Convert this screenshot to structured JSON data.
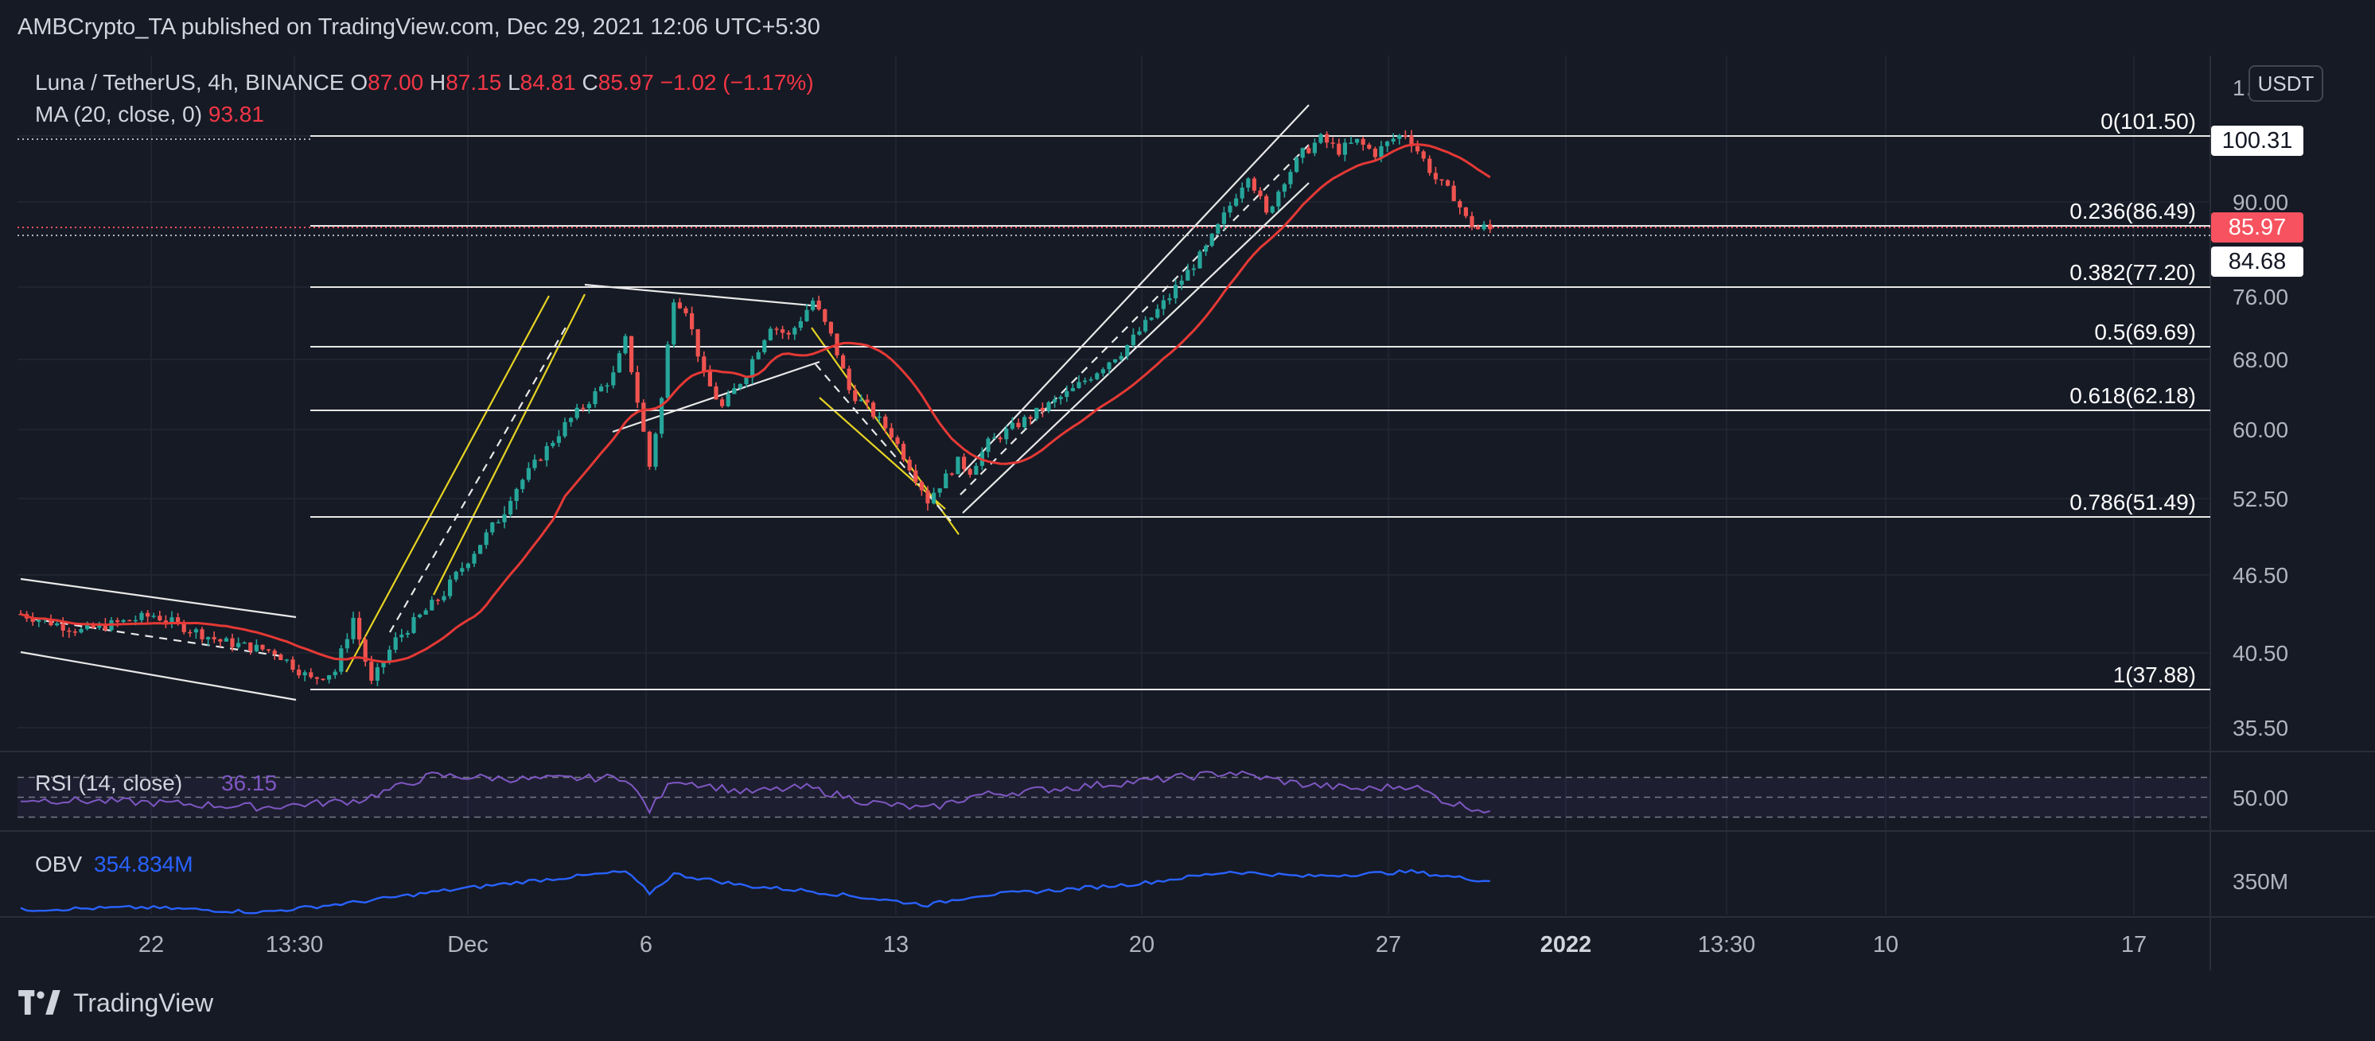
{
  "publisher": "AMBCrypto_TA published on TradingView.com, Dec 29, 2021 12:06 UTC+5:30",
  "symbol": {
    "pair": "Luna / TetherUS, 4h, BINANCE",
    "o_label": "O",
    "o": "87.00",
    "h_label": "H",
    "h": "87.15",
    "l_label": "L",
    "l": "84.81",
    "c_label": "C",
    "c": "85.97",
    "change": "−1.02 (−1.17%)"
  },
  "ma": {
    "label": "MA (20, close, 0)",
    "value": "93.81"
  },
  "currency_button": "USDT",
  "price_boxes": {
    "top": "100.31",
    "last": "85.97",
    "low": "84.68"
  },
  "brand": "TradingView",
  "colors": {
    "background": "#161a25",
    "bull": "#26a69a",
    "bear": "#ef5350",
    "ma": "#e53935",
    "rsi": "#7e57c2",
    "obv": "#2962ff",
    "channel_yellow": "#e6d323",
    "grid": "#232735"
  },
  "chart_data": {
    "type": "candlestick",
    "title": "Luna / TetherUS, 4h, BINANCE",
    "price_axis": {
      "ticks": [
        "1…",
        "90.00",
        "76.00",
        "68.00",
        "60.00",
        "52.50",
        "46.50",
        "40.50",
        "35.50"
      ],
      "tick_values": [
        110,
        90,
        76,
        68,
        60,
        52.5,
        46.5,
        40.5,
        35.5
      ]
    },
    "time_axis": {
      "ticks": [
        "22",
        "13:30",
        "Dec",
        "6",
        "13",
        "20",
        "27",
        "2022",
        "13:30",
        "10",
        "17"
      ]
    },
    "fibonacci": [
      {
        "label": "0(101.50)",
        "level": 101.5
      },
      {
        "label": "0.236(86.49)",
        "level": 86.49
      },
      {
        "label": "0.382(77.20)",
        "level": 77.2
      },
      {
        "label": "0.5(69.69)",
        "level": 69.69
      },
      {
        "label": "0.618(62.18)",
        "level": 62.18
      },
      {
        "label": "0.786(51.49)",
        "level": 51.49
      },
      {
        "label": "1(37.88)",
        "level": 37.88
      }
    ],
    "price_path": [
      [
        0,
        43.5
      ],
      [
        10,
        42.2
      ],
      [
        22,
        43.4
      ],
      [
        33,
        41.4
      ],
      [
        42,
        40.6
      ],
      [
        48,
        38.6
      ],
      [
        52,
        39.2
      ],
      [
        55,
        43.2
      ],
      [
        58,
        38.3
      ],
      [
        62,
        41.5
      ],
      [
        70,
        45.1
      ],
      [
        80,
        52.0
      ],
      [
        90,
        60.5
      ],
      [
        98,
        66.2
      ],
      [
        100,
        70.5
      ],
      [
        104,
        56.0
      ],
      [
        106,
        63.5
      ],
      [
        108,
        76.0
      ],
      [
        110,
        74.5
      ],
      [
        113,
        66.0
      ],
      [
        116,
        62.5
      ],
      [
        120,
        66.5
      ],
      [
        124,
        72.5
      ],
      [
        127,
        71.0
      ],
      [
        131,
        75.5
      ],
      [
        134,
        71.0
      ],
      [
        137,
        64.5
      ],
      [
        140,
        62.5
      ],
      [
        144,
        59.5
      ],
      [
        147,
        56.0
      ],
      [
        150,
        52.5
      ],
      [
        152,
        54.0
      ],
      [
        155,
        56.5
      ],
      [
        157,
        55.5
      ],
      [
        160,
        58.5
      ],
      [
        167,
        61.5
      ],
      [
        174,
        64.5
      ],
      [
        182,
        69.0
      ],
      [
        190,
        76.0
      ],
      [
        196,
        83.0
      ],
      [
        200,
        89.5
      ],
      [
        203,
        95.0
      ],
      [
        206,
        88.0
      ],
      [
        209,
        94.0
      ],
      [
        212,
        98.5
      ],
      [
        215,
        101.0
      ],
      [
        218,
        99.0
      ],
      [
        221,
        100.5
      ],
      [
        224,
        98.5
      ],
      [
        227,
        101.0
      ],
      [
        229,
        102.0
      ],
      [
        231,
        99.0
      ],
      [
        234,
        94.0
      ],
      [
        237,
        91.0
      ],
      [
        239,
        87.5
      ],
      [
        241,
        86.0
      ],
      [
        243,
        86.5
      ]
    ],
    "ma_20": {
      "label": "MA (20, close, 0)",
      "last": 93.81
    },
    "last_close": 85.97,
    "rsi": {
      "label": "RSI (14, close)",
      "value": "36.15",
      "tick": "50.00",
      "bands": [
        70,
        50,
        30
      ],
      "path": [
        [
          0,
          48
        ],
        [
          20,
          45
        ],
        [
          40,
          40
        ],
        [
          56,
          47
        ],
        [
          68,
          72
        ],
        [
          84,
          68
        ],
        [
          100,
          70
        ],
        [
          104,
          37
        ],
        [
          108,
          68
        ],
        [
          120,
          55
        ],
        [
          130,
          60
        ],
        [
          140,
          45
        ],
        [
          150,
          38
        ],
        [
          158,
          52
        ],
        [
          170,
          58
        ],
        [
          185,
          66
        ],
        [
          200,
          75
        ],
        [
          212,
          63
        ],
        [
          222,
          58
        ],
        [
          230,
          62
        ],
        [
          236,
          45
        ],
        [
          243,
          36
        ]
      ]
    },
    "obv": {
      "label": "OBV",
      "value": "354.834M",
      "tick": "350M",
      "path": [
        [
          0,
          340
        ],
        [
          20,
          341
        ],
        [
          40,
          339
        ],
        [
          55,
          343
        ],
        [
          70,
          348
        ],
        [
          84,
          352
        ],
        [
          100,
          356
        ],
        [
          104,
          347
        ],
        [
          108,
          355
        ],
        [
          120,
          350
        ],
        [
          130,
          348
        ],
        [
          140,
          345
        ],
        [
          150,
          342
        ],
        [
          158,
          346
        ],
        [
          170,
          348
        ],
        [
          185,
          351
        ],
        [
          200,
          356
        ],
        [
          212,
          354
        ],
        [
          222,
          355
        ],
        [
          230,
          356
        ],
        [
          236,
          354
        ],
        [
          243,
          352
        ]
      ]
    }
  }
}
